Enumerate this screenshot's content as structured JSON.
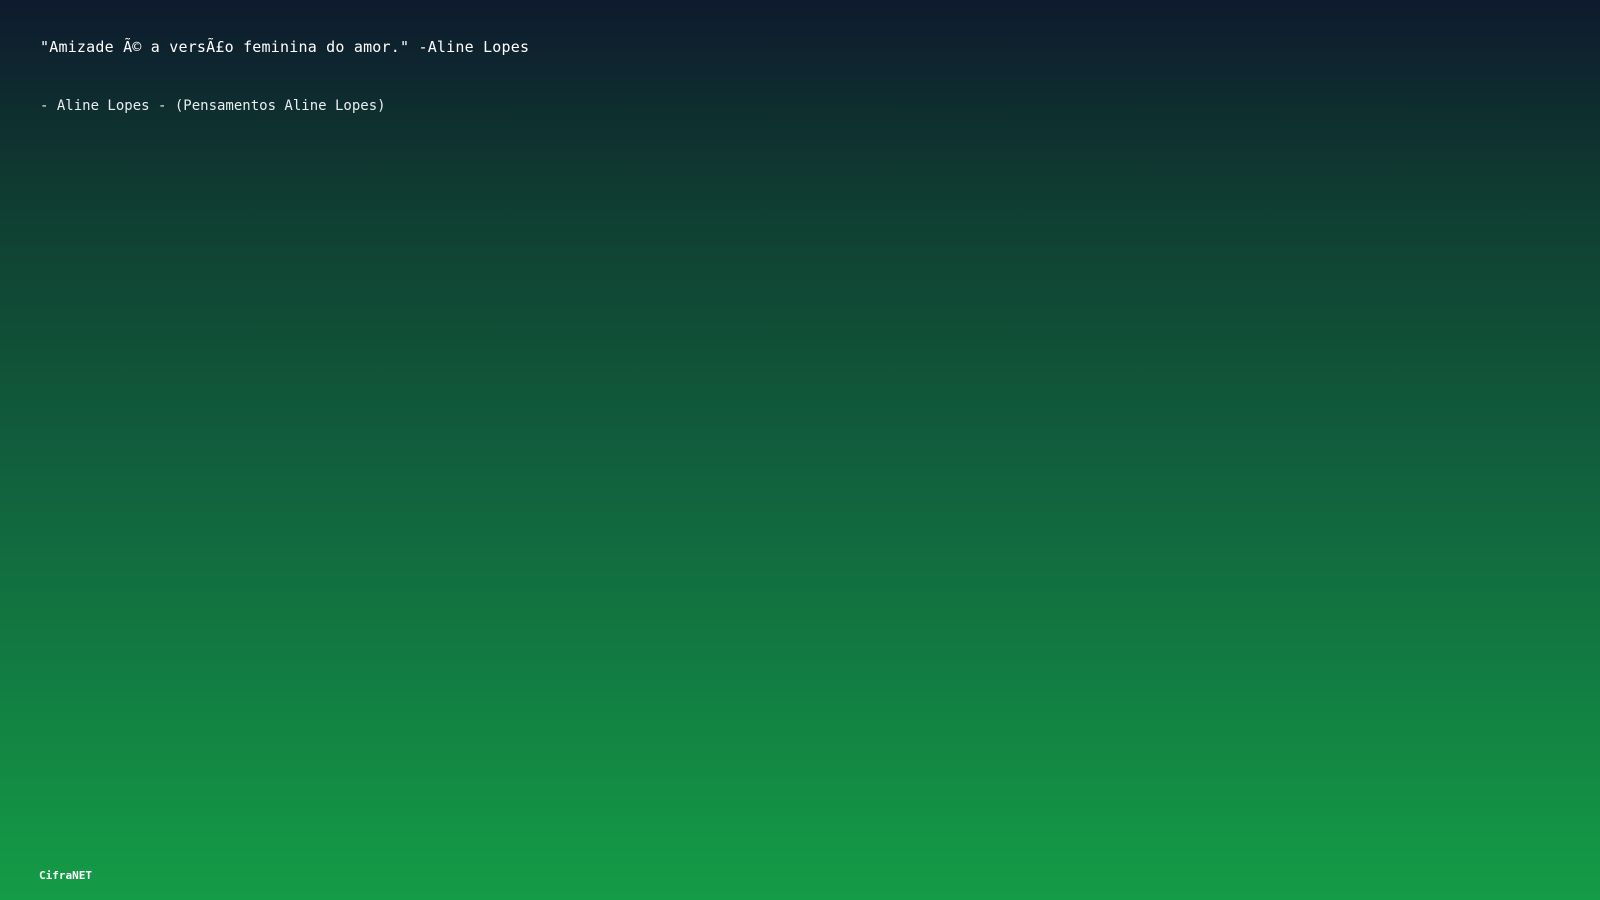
{
  "quote": {
    "text": "\"Amizade Ã© a versÃ£o feminina do amor.\" -Aline Lopes"
  },
  "attribution": {
    "text": "- Aline Lopes - (Pensamentos Aline Lopes)"
  },
  "footer": {
    "brand": "CifraNET"
  },
  "colors": {
    "gradient_top": "#0e1a2e",
    "gradient_bottom": "#149c46",
    "text": "#ffffff"
  }
}
